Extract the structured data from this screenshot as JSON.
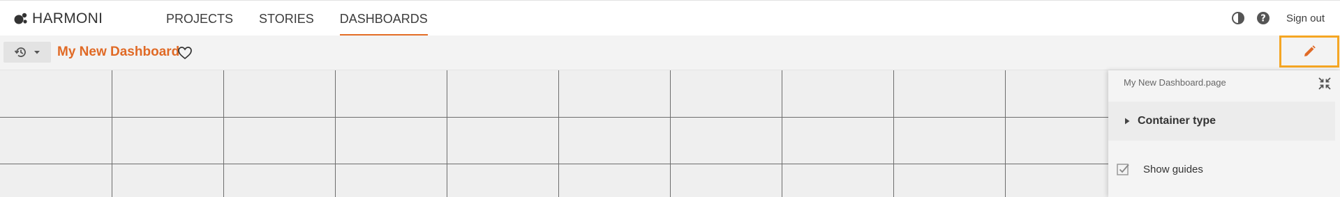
{
  "brand": {
    "name": "HARMONI",
    "logo_icon": "harmoni-logo-icon"
  },
  "nav": {
    "items": [
      {
        "label": "PROJECTS",
        "active": false
      },
      {
        "label": "STORIES",
        "active": false
      },
      {
        "label": "DASHBOARDS",
        "active": true
      }
    ]
  },
  "top_right": {
    "theme_icon": "contrast-icon",
    "help_icon": "help-icon",
    "signout_label": "Sign out"
  },
  "toolbar": {
    "history_icon": "history-icon",
    "dropdown_icon": "caret-down-icon",
    "title": "My New Dashboard",
    "favorite_icon": "heart-outline-icon",
    "edit_icon": "pencil-icon"
  },
  "panel": {
    "file_name": "My New Dashboard.page",
    "collapse_icon": "collapse-arrows-icon",
    "section_label": "Container type",
    "show_guides_label": "Show guides",
    "show_guides_checked": true
  },
  "colors": {
    "accent": "#e36c25",
    "highlight_border": "#f5a623",
    "grid_line": "#6d6d6d"
  }
}
